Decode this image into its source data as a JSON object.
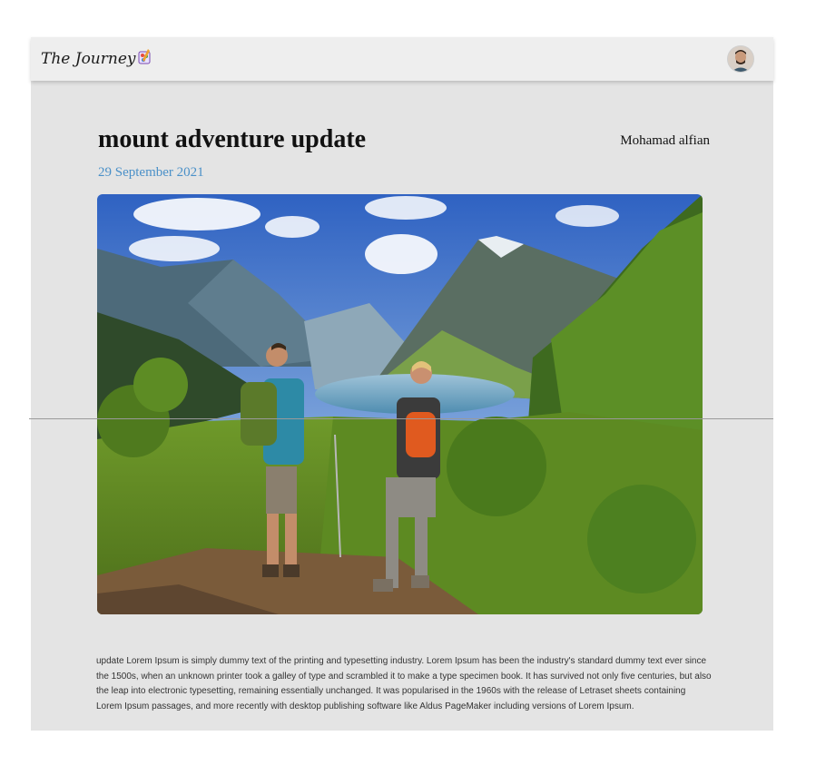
{
  "navbar": {
    "logo_text": "The Journey",
    "logo_icon": "pencil-palette-icon",
    "avatar_icon": "user-avatar"
  },
  "article": {
    "title": "mount adventure update",
    "author": "Mohamad alfian",
    "date": "29 September 2021",
    "image": "hikers-mountain-lake-photo",
    "body": "update Lorem Ipsum is simply dummy text of the printing and typesetting industry. Lorem Ipsum has been the industry's standard dummy text ever since the 1500s, when an unknown printer took a galley of type and scrambled it to make a type specimen book. It has survived not only five centuries, but also the leap into electronic typesetting, remaining essentially unchanged. It was popularised in the 1960s with the release of Letraset sheets containing Lorem Ipsum passages, and more recently with desktop publishing software like Aldus PageMaker including versions of Lorem Ipsum."
  },
  "colors": {
    "background": "#e4e4e4",
    "navbar": "#eeeeee",
    "date": "#4a90c8",
    "title": "#111111"
  }
}
